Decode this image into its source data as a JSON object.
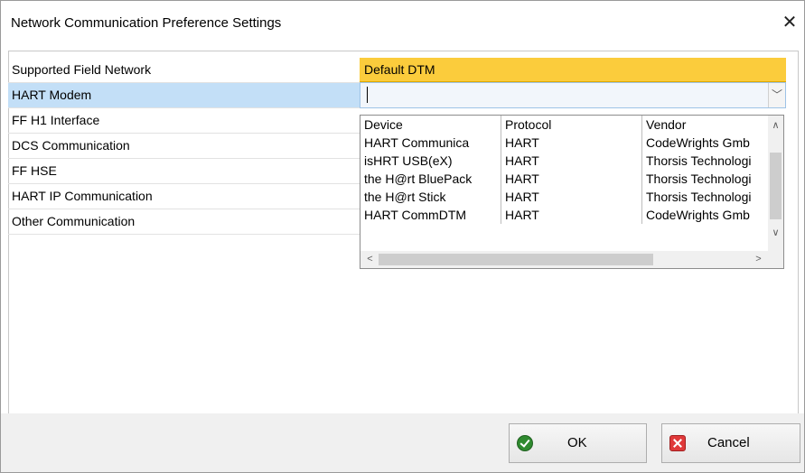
{
  "window": {
    "title": "Network Communication Preference Settings",
    "close_label": "✕"
  },
  "network_list": {
    "items": [
      {
        "label": "Supported Field Network"
      },
      {
        "label": "HART Modem"
      },
      {
        "label": "FF H1 Interface"
      },
      {
        "label": "DCS Communication"
      },
      {
        "label": "FF HSE"
      },
      {
        "label": "HART IP Communication"
      },
      {
        "label": "Other Communication"
      }
    ],
    "selected_index": 1
  },
  "dtm_panel": {
    "header": "Default DTM",
    "combo_value": "",
    "combo_arrow": "﹀"
  },
  "device_grid": {
    "columns": [
      "Device",
      "Protocol",
      "Vendor"
    ],
    "rows": [
      [
        "HART Communica",
        "HART",
        "CodeWrights Gmb"
      ],
      [
        "isHRT USB(eX)",
        "HART",
        "Thorsis Technologi"
      ],
      [
        "the H@rt BluePack",
        "HART",
        "Thorsis Technologi"
      ],
      [
        "the H@rt Stick",
        "HART",
        "Thorsis Technologi"
      ],
      [
        "HART CommDTM",
        "HART",
        "CodeWrights Gmb"
      ]
    ],
    "scroll_up": "∧",
    "scroll_down": "∨",
    "scroll_left": "<",
    "scroll_right": ">"
  },
  "buttons": {
    "ok_label": "OK",
    "cancel_label": "Cancel"
  },
  "colors": {
    "selection": "#c3dff7",
    "header_accent": "#fbcc3c"
  }
}
